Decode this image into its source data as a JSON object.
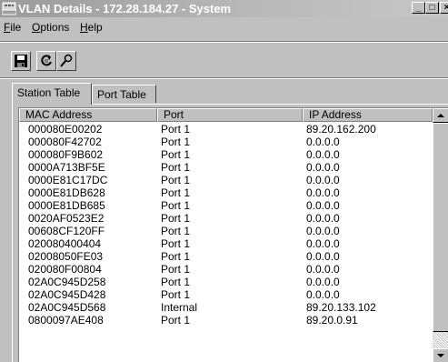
{
  "window": {
    "title": "VLAN Details - 172.28.184.27 - System",
    "minimize_glyph": "_",
    "maximize_glyph": "□",
    "close_glyph": "×"
  },
  "menu": [
    {
      "accel": "F",
      "rest": "ile"
    },
    {
      "accel": "O",
      "rest": "ptions"
    },
    {
      "accel": "H",
      "rest": "elp"
    }
  ],
  "toolbar": {
    "icons": [
      "save-icon",
      "refresh-icon",
      "find-icon"
    ]
  },
  "tabs": [
    "Station Table",
    "Port Table"
  ],
  "table": {
    "columns": [
      "MAC Address",
      "Port",
      "IP Address"
    ],
    "rows": [
      [
        "000080E00202",
        "Port 1",
        "89.20.162.200"
      ],
      [
        "000080F42702",
        "Port 1",
        "0.0.0.0"
      ],
      [
        "000080F9B602",
        "Port 1",
        "0.0.0.0"
      ],
      [
        "0000A713BF5E",
        "Port 1",
        "0.0.0.0"
      ],
      [
        "0000E81C17DC",
        "Port 1",
        "0.0.0.0"
      ],
      [
        "0000E81DB628",
        "Port 1",
        "0.0.0.0"
      ],
      [
        "0000E81DB685",
        "Port 1",
        "0.0.0.0"
      ],
      [
        "0020AF0523E2",
        "Port 1",
        "0.0.0.0"
      ],
      [
        "00608CF120FF",
        "Port 1",
        "0.0.0.0"
      ],
      [
        "020080400404",
        "Port 1",
        "0.0.0.0"
      ],
      [
        "02008050FE03",
        "Port 1",
        "0.0.0.0"
      ],
      [
        "020080F00804",
        "Port 1",
        "0.0.0.0"
      ],
      [
        "02A0C945D258",
        "Port 1",
        "0.0.0.0"
      ],
      [
        "02A0C945D428",
        "Port 1",
        "0.0.0.0"
      ],
      [
        "02A0C945D568",
        "Internal",
        "89.20.133.102"
      ],
      [
        "0800097AE408",
        "Port 1",
        "89.20.0.91"
      ]
    ]
  }
}
